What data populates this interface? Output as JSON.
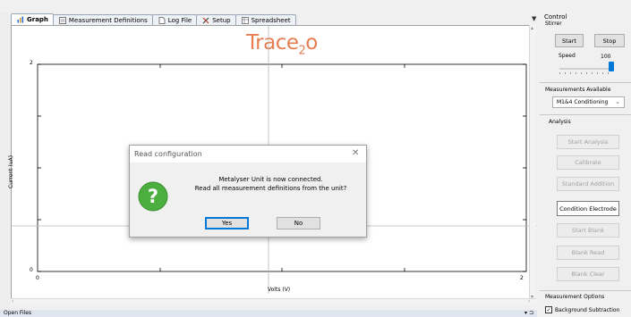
{
  "tabs": [
    {
      "label": "Graph",
      "icon": "chart-icon",
      "active": true
    },
    {
      "label": "Measurement Definitions",
      "icon": "definitions-icon",
      "active": false
    },
    {
      "label": "Log File",
      "icon": "document-icon",
      "active": false
    },
    {
      "label": "Setup",
      "icon": "tools-icon",
      "active": false
    },
    {
      "label": "Spreadsheet",
      "icon": "spreadsheet-icon",
      "active": false
    }
  ],
  "logo": {
    "text": "Trace",
    "sub": "2",
    "tail": "o"
  },
  "graph": {
    "ylabel": "Current (uA)",
    "xlabel": "Volts (V)",
    "y_ticks": [
      "2",
      "0"
    ],
    "x_ticks": [
      "0",
      "2"
    ]
  },
  "open_files": {
    "label": "Open Files",
    "pin": "▾ ⊐"
  },
  "control": {
    "title": "Control",
    "stirrer": {
      "label": "Stirrer",
      "start": "Start",
      "stop": "Stop",
      "speed_label": "Speed",
      "speed_value": "100"
    },
    "measurements": {
      "label": "Measurements Available",
      "selected": "M1&4 Conditioning"
    },
    "analysis": {
      "label": "Analysis",
      "buttons": [
        {
          "label": "Start Analysis",
          "enabled": false
        },
        {
          "label": "Calibrate",
          "enabled": false
        },
        {
          "label": "Standard Addition",
          "enabled": false
        },
        {
          "label": "Condition Electrode",
          "enabled": true
        },
        {
          "label": "Start Blank",
          "enabled": false
        },
        {
          "label": "Blank Read",
          "enabled": false
        },
        {
          "label": "Blank Clear",
          "enabled": false
        }
      ]
    },
    "options": {
      "label": "Measurement Options",
      "background_subtraction": "Background Subtraction",
      "background_checked": true
    }
  },
  "dialog": {
    "title": "Read configuration",
    "line1": "Metalyser Unit is now connected.",
    "line2": "Read all measurement definitions from the unit?",
    "yes": "Yes",
    "no": "No",
    "icon_glyph": "?"
  },
  "colors": {
    "accent": "#0078d7",
    "logo": "#e67e52",
    "question": "#4cae3f"
  }
}
